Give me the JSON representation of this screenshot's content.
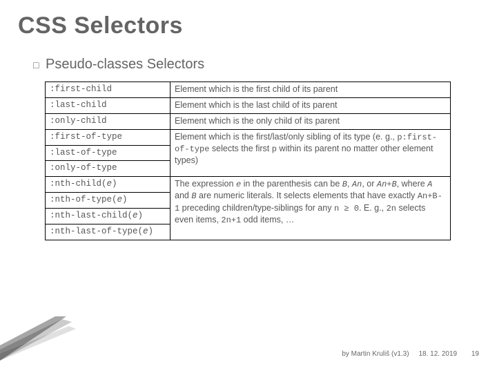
{
  "title": "CSS Selectors",
  "subtitle": "Pseudo-classes Selectors",
  "rows": [
    {
      "sel": ":first-child",
      "desc": "Element which is the first child of its parent",
      "rowspan": 1
    },
    {
      "sel": ":last-child",
      "desc": "Element which is the last child of its parent",
      "rowspan": 1
    },
    {
      "sel": ":only-child",
      "desc": "Element which is the only child of its parent",
      "rowspan": 1
    },
    {
      "sel": ":first-of-type",
      "desc": "Element which is the first/last/only sibling of its type (e. g., p:first-of-type selects the first p within its parent no matter other element types)",
      "rowspan": 3
    },
    {
      "sel": ":last-of-type"
    },
    {
      "sel": ":only-of-type"
    },
    {
      "sel": ":nth-child(e)",
      "desc": "The expression e in the parenthesis can be B, An, or An+B, where A and B are numeric literals. It selects elements that have exactly An+B-1 preceding children/type-siblings for any n ≥ 0. E. g., 2n selects even items, 2n+1 odd items, …",
      "rowspan": 4
    },
    {
      "sel": ":nth-of-type(e)"
    },
    {
      "sel": ":nth-last-child(e)"
    },
    {
      "sel": ":nth-last-of-type(e)"
    }
  ],
  "desc_html": {
    "3": "Element which is the first/last/only sibling of its type (e. g., <span class=\"code\">p:first-of-type</span> selects the first <span class=\"code\">p</span> within its parent no matter other element types)",
    "6": "The expression <span class=\"code emph\">e</span> in the parenthesis can be <span class=\"code emph\">B</span>, <span class=\"code emph\">An</span>, or <span class=\"code emph\">An+B</span>, where <span class=\"code emph\">A</span> and <span class=\"code emph\">B</span> are numeric literals. It selects elements that have exactly <span class=\"code\">An+B-1</span> preceding children/type-siblings for any <span class=\"code\">n ≥ 0</span>. E. g., <span class=\"code\">2n</span> selects even items, <span class=\"code\">2n+1</span> odd items, …"
  },
  "sel_html": {
    "6": ":nth-child(<span class=\"emph\">e</span>)",
    "7": ":nth-of-type(<span class=\"emph\">e</span>)",
    "8": ":nth-last-child(<span class=\"emph\">e</span>)",
    "9": ":nth-last-of-type(<span class=\"emph\">e</span>)"
  },
  "footer": {
    "author": "by Martin Kruliš (v1.3)",
    "date": "18. 12. 2019",
    "page": "19"
  }
}
